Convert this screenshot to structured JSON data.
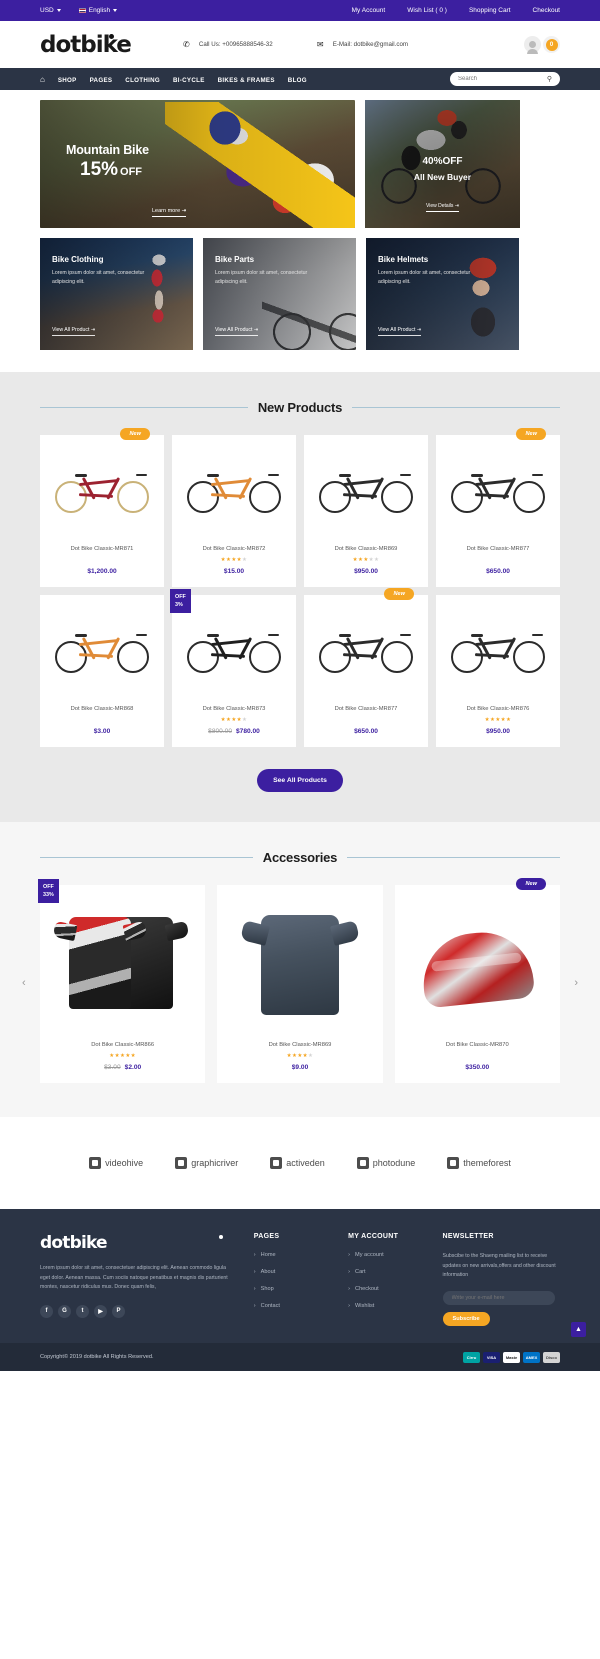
{
  "topbar": {
    "currency": "USD",
    "language": "English",
    "links": [
      "My Account",
      "Wish List ( 0 )",
      "Shopping Cart",
      "Checkout"
    ]
  },
  "header": {
    "logo": "dotbike",
    "phone_label": "Call Us: +00965888546-32",
    "email_label": "E-Mail: dotbike@gmail.com",
    "cart_count": "0"
  },
  "nav": {
    "items": [
      "SHOP",
      "PAGES",
      "CLOTHING",
      "BI-CYCLE",
      "BIKES & FRAMES",
      "BLOG"
    ],
    "search_placeholder": "Search"
  },
  "hero": {
    "main": {
      "title": "Mountain Bike",
      "percent": "15%",
      "off": "OFF",
      "cta": "Learn more ⇥"
    },
    "side": {
      "percent": "40%",
      "off": "OFF",
      "subtitle": "All New Buyer",
      "cta": "View Details ⇥"
    }
  },
  "categories": [
    {
      "title": "Bike Clothing",
      "desc": "Lorem ipsum dolor sit amet, consectetur adipiscing elit.",
      "cta": "View All Product ⇥"
    },
    {
      "title": "Bike Parts",
      "desc": "Lorem ipsum dolor sit amet, consectetur adipiscing elit.",
      "cta": "View All Product ⇥"
    },
    {
      "title": "Bike Helmets",
      "desc": "Lorem ipsum dolor sit amet, consectetur adipiscing elit.",
      "cta": "View All Product ⇥"
    }
  ],
  "new_products": {
    "title": "New Products",
    "see_all": "See All Products",
    "items": [
      {
        "name": "Dot Bike Classic-MR871",
        "price": "$1,200.00",
        "old_price": "",
        "rating": 0,
        "badge": "New",
        "badge_type": "new",
        "frame": "#9c2230",
        "wheel": "#c9b278"
      },
      {
        "name": "Dot Bike Classic-MR872",
        "price": "$15.00",
        "old_price": "",
        "rating": 4,
        "badge": "",
        "badge_type": "",
        "frame": "#e08b37",
        "wheel": "#2b2b2b"
      },
      {
        "name": "Dot Bike Classic-MR869",
        "price": "$950.00",
        "old_price": "",
        "rating": 3,
        "badge": "",
        "badge_type": "",
        "frame": "#2b2b2b",
        "wheel": "#2b2b2b"
      },
      {
        "name": "Dot Bike Classic-MR877",
        "price": "$650.00",
        "old_price": "",
        "rating": 0,
        "badge": "New",
        "badge_type": "new",
        "frame": "#2b2b2b",
        "wheel": "#2b2b2b"
      },
      {
        "name": "Dot Bike Classic-MR868",
        "price": "$3.00",
        "old_price": "",
        "rating": 0,
        "badge": "",
        "badge_type": "",
        "frame": "#e08b37",
        "wheel": "#2b2b2b"
      },
      {
        "name": "Dot Bike Classic-MR873",
        "price": "$780.00",
        "old_price": "$800.00",
        "rating": 4,
        "badge": "OFF 3%",
        "badge_type": "off",
        "frame": "#1f1f1f",
        "wheel": "#2b2b2b"
      },
      {
        "name": "Dot Bike Classic-MR877",
        "price": "$650.00",
        "old_price": "",
        "rating": 0,
        "badge": "New",
        "badge_type": "new",
        "frame": "#2b2b2b",
        "wheel": "#2b2b2b"
      },
      {
        "name": "Dot Bike Classic-MR876",
        "price": "$950.00",
        "old_price": "",
        "rating": 5,
        "badge": "",
        "badge_type": "",
        "frame": "#2b2b2b",
        "wheel": "#2b2b2b"
      }
    ]
  },
  "accessories": {
    "title": "Accessories",
    "prev": "‹",
    "next": "›",
    "items": [
      {
        "name": "Dot Bike Classic-MR866",
        "price": "$2.00",
        "old_price": "$3.00",
        "rating": 5,
        "badge": "OFF 33%",
        "badge_type": "off"
      },
      {
        "name": "Dot Bike Classic-MR869",
        "price": "$9.00",
        "old_price": "",
        "rating": 4,
        "badge": "",
        "badge_type": ""
      },
      {
        "name": "Dot Bike Classic-MR870",
        "price": "$350.00",
        "old_price": "",
        "rating": 0,
        "badge": "New",
        "badge_type": "new"
      }
    ]
  },
  "brands": [
    "videohive",
    "graphicriver",
    "activeden",
    "photodune",
    "themeforest"
  ],
  "footer": {
    "logo": "dotbike",
    "desc": "Lorem ipsum dolor sit amet, consectetuer adipiscing elit. Aenean commodo ligula eget dolor. Aenean massa. Cum sociis natoque penatibus et magnis dis parturient montes, nascetur ridiculus mus. Donec quam felis,",
    "socials": [
      "f",
      "G",
      "t",
      "▶",
      "P"
    ],
    "pages": {
      "title": "PAGES",
      "items": [
        "Home",
        "About",
        "Shop",
        "Contact"
      ]
    },
    "account": {
      "title": "MY ACCOUNT",
      "items": [
        "My account",
        "Cart",
        "Checkout",
        "Wishlist"
      ]
    },
    "newsletter": {
      "title": "NEWSLETTER",
      "desc": "Subscibe to the Shaeng mailing list to receive updates on new arrivals,offers and other discount information",
      "placeholder": "Write your e-mail here",
      "button": "Subscribe"
    },
    "copyright": "Copyright© 2019 dotbike All Rights Reserved.",
    "payments": [
      "Cirrus",
      "VISA",
      "MasterCard",
      "AMEX",
      "Discover"
    ],
    "to_top": "▲"
  },
  "colors": {
    "primary": "#3c1fa0",
    "accent": "#f5a623",
    "dark": "#2b3445"
  }
}
